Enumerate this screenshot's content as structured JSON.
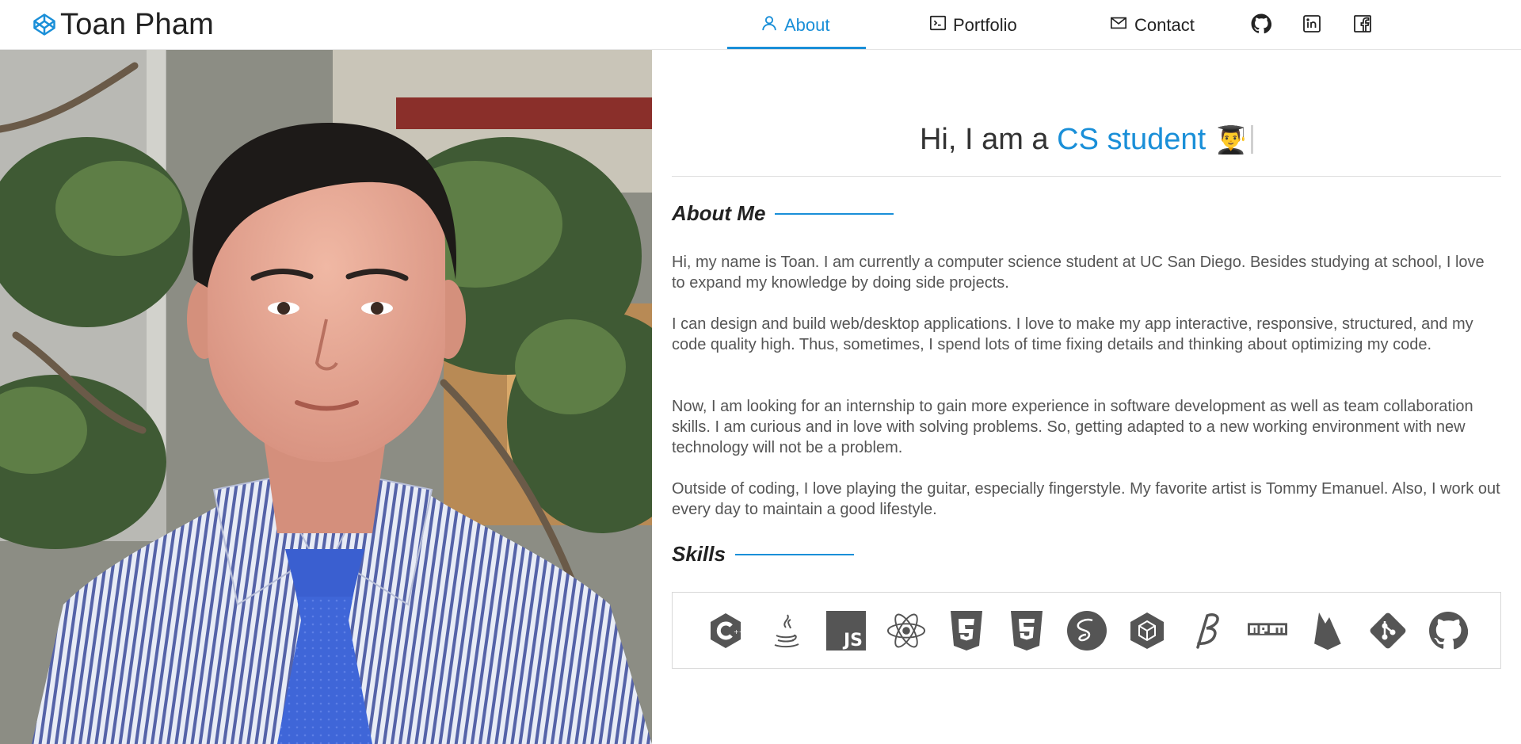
{
  "brand": {
    "name": "Toan Pham",
    "logo_icon": "codepen-icon"
  },
  "nav": {
    "items": [
      {
        "label": "About",
        "icon": "user-icon",
        "active": true
      },
      {
        "label": "Portfolio",
        "icon": "terminal-icon",
        "active": false
      },
      {
        "label": "Contact",
        "icon": "mail-icon",
        "active": false
      }
    ],
    "social": [
      "github-icon",
      "linkedin-icon",
      "facebook-icon"
    ]
  },
  "hero": {
    "prefix": "Hi, I am a ",
    "highlight": "CS student",
    "emoji": "👨‍🎓"
  },
  "about": {
    "title": "About Me",
    "paragraphs": [
      "Hi, my name is Toan. I am currently a computer science student at UC San Diego. Besides studying at school, I love to expand my knowledge by doing side projects.",
      "I can design and build web/desktop applications. I love to make my app interactive, responsive, structured, and my code quality high. Thus, sometimes, I spend lots of time fixing details and thinking about optimizing my code.",
      "Now, I am looking for an internship to gain more experience in software development as well as team collaboration skills. I am curious and in love with solving problems. So, getting adapted to a new working environment with new technology will not be a problem.",
      "Outside of coding, I love playing the guitar, especially fingerstyle. My favorite artist is Tommy Emanuel. Also, I work out every day to maintain a good lifestyle."
    ]
  },
  "skills": {
    "title": "Skills",
    "icons": [
      "cplusplus-icon",
      "java-icon",
      "javascript-icon",
      "react-icon",
      "css3-icon",
      "html5-icon",
      "sass-icon",
      "webpack-icon",
      "babel-icon",
      "npm-icon",
      "firebase-icon",
      "git-icon",
      "github-icon"
    ]
  },
  "colors": {
    "accent": "#1a8fd8",
    "text": "#555555",
    "heading": "#222222"
  }
}
